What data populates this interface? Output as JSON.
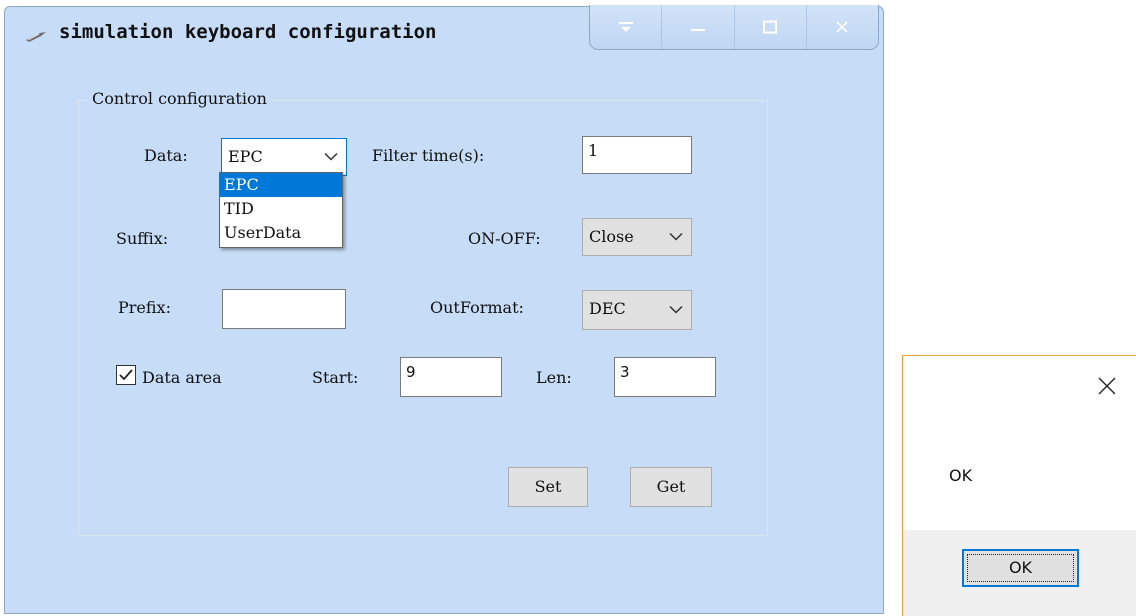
{
  "window": {
    "title": "simulation keyboard configuration",
    "caption_buttons": [
      "menu-icon",
      "minimize-icon",
      "maximize-icon",
      "close-icon"
    ]
  },
  "group": {
    "legend": "Control configuration"
  },
  "form": {
    "data_label": "Data:",
    "data_value": "EPC",
    "data_options": [
      "EPC",
      "TID",
      "UserData"
    ],
    "filter_label": "Filter time(s):",
    "filter_value": "1",
    "suffix_label": "Suffix:",
    "onoff_label": "ON-OFF:",
    "onoff_value": "Close",
    "prefix_label": "Prefix:",
    "prefix_value": "",
    "outformat_label": "OutFormat:",
    "outformat_value": "DEC",
    "data_area_label": "Data area",
    "data_area_checked": true,
    "start_label": "Start:",
    "start_value": "9",
    "len_label": "Len:",
    "len_value": "3",
    "set_label": "Set",
    "get_label": "Get"
  },
  "message_box": {
    "text": "OK",
    "ok_label": "OK"
  },
  "colors": {
    "window_bg": "#c6dcf7",
    "selection": "#0078d7",
    "msgbox_border": "#e6a33a"
  }
}
